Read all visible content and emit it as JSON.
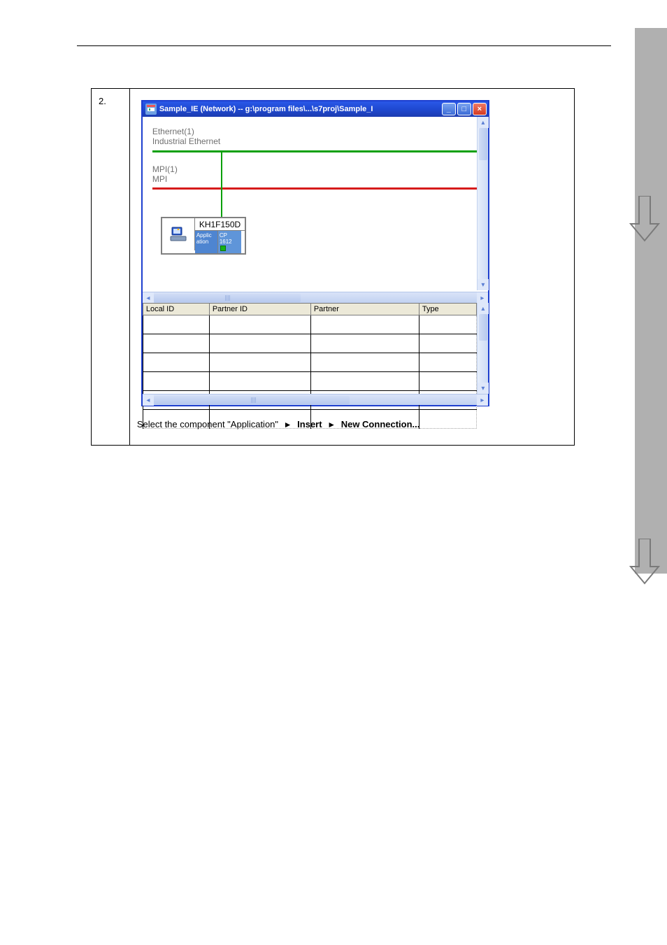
{
  "step_number": "2.",
  "window": {
    "title": "Sample_IE (Network) -- g:\\program files\\...\\s7proj\\Sample_I"
  },
  "networks": {
    "ethernet_name": "Ethernet(1)",
    "ethernet_type": "Industrial Ethernet",
    "mpi_name": "MPI(1)",
    "mpi_type": "MPI"
  },
  "station": {
    "name": "KH1F150D",
    "slots": [
      {
        "label": "Applic\nation"
      },
      {
        "label": "CP\n1612"
      }
    ]
  },
  "conn_table": {
    "headers": [
      "Local ID",
      "Partner ID",
      "Partner",
      "Type"
    ]
  },
  "caption": {
    "prefix": "Select the component \"Application\"",
    "menu_path1": "Insert",
    "menu_path2": "New Connection..."
  },
  "colors": {
    "ethernet_bar": "#0ba00b",
    "mpi_bar": "#d61b1b",
    "titlebar": "#1f49d1"
  }
}
